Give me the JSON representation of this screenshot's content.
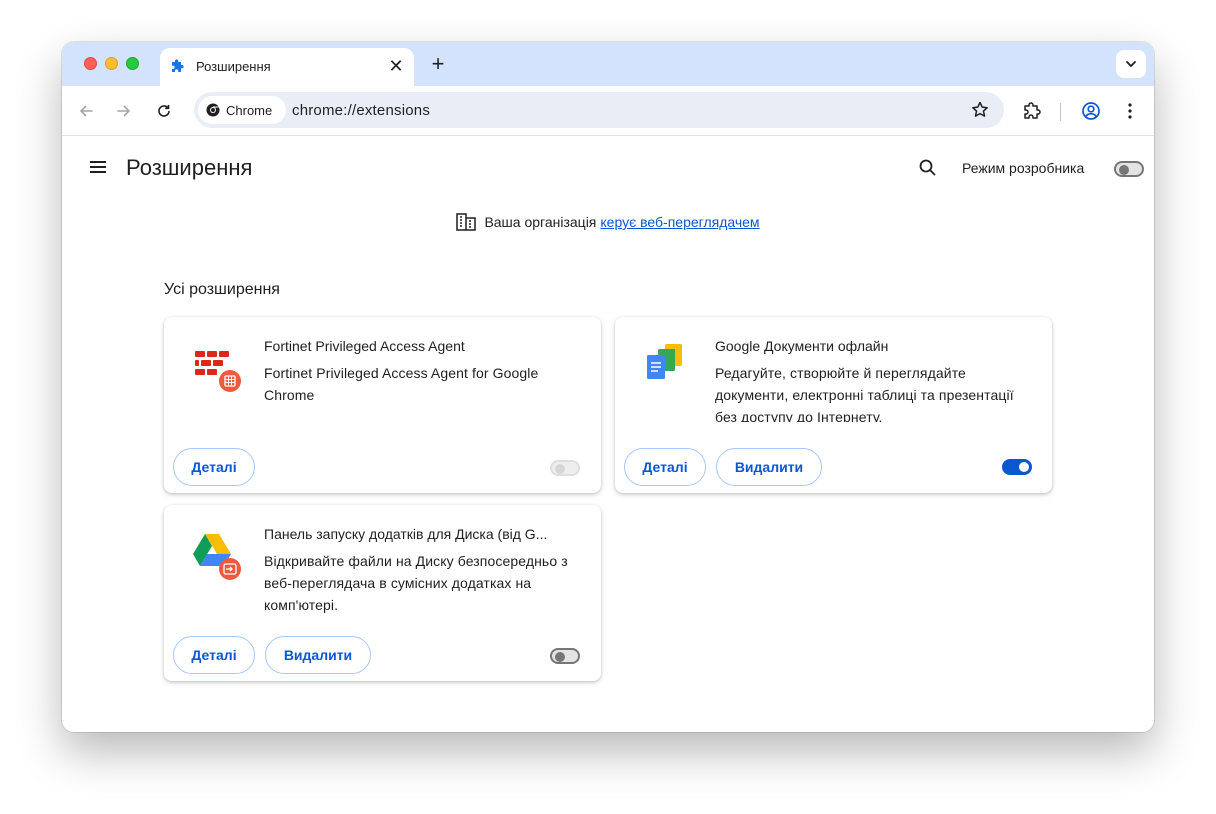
{
  "tab": {
    "title": "Розширення",
    "close": "✕",
    "new_tab": "+"
  },
  "omnibox": {
    "chip_label": "Chrome",
    "url": "chrome://extensions"
  },
  "page": {
    "title": "Розширення",
    "dev_mode_label": "Режим розробника",
    "dev_mode_on": false,
    "managed_text": "Ваша організація",
    "managed_link": "керує веб-переглядачем",
    "section_title": "Усі розширення"
  },
  "extensions": [
    {
      "name": "Fortinet Privileged Access Agent",
      "description": "Fortinet Privileged Access Agent for Google Chrome",
      "details_label": "Деталі",
      "enabled": false,
      "toggle_state": "disabled"
    },
    {
      "name": "Google Документи офлайн",
      "description": "Редагуйте, створюйте й переглядайте документи, електронні таблиці та презентації без доступу до Інтернету.",
      "details_label": "Деталі",
      "remove_label": "Видалити",
      "enabled": true,
      "toggle_state": "on"
    },
    {
      "name": "Панель запуску додатків для Диска (від G...",
      "description": "Відкривайте файли на Диску безпосередньо з веб-переглядача в сумісних додатках на комп'ютері.",
      "details_label": "Деталі",
      "remove_label": "Видалити",
      "enabled": false,
      "toggle_state": "off"
    }
  ],
  "colors": {
    "accent": "#0b57d0",
    "tabstrip": "#d3e3fd",
    "omnibox": "#e9eef6"
  }
}
